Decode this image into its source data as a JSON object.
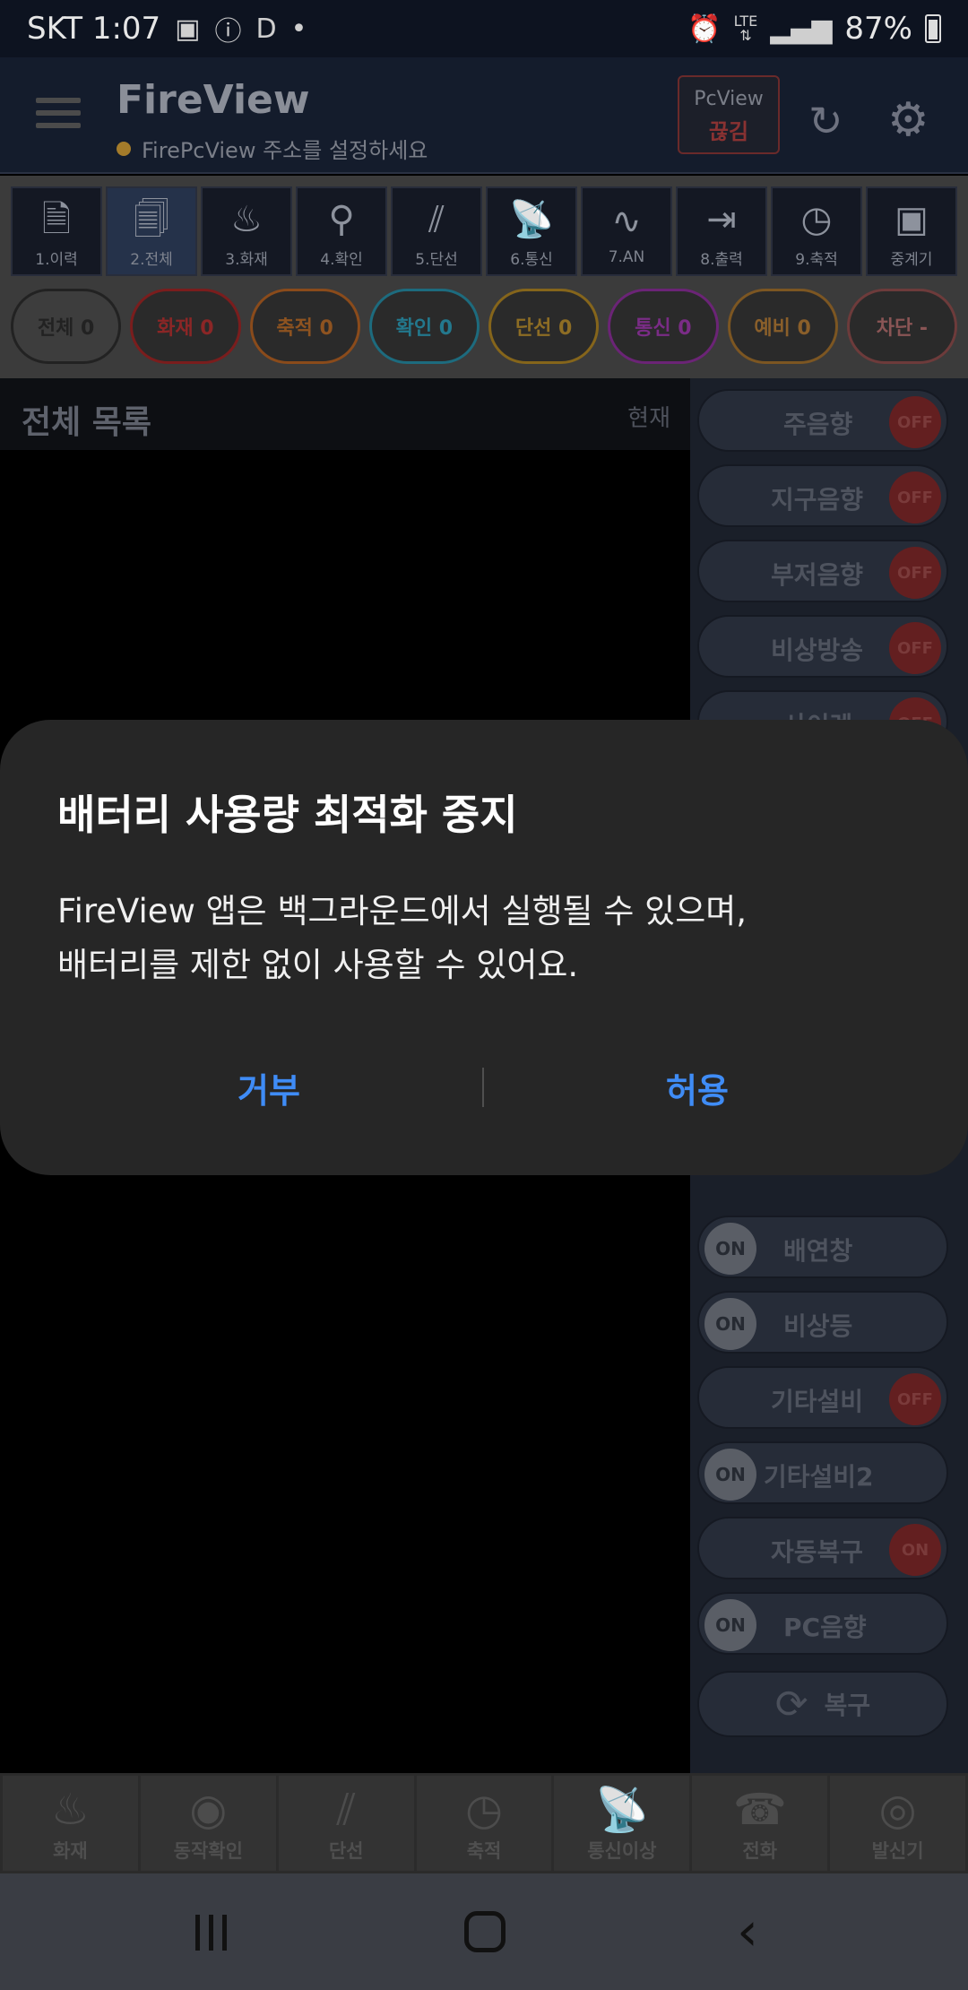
{
  "status_bar": {
    "carrier_time": "SKT 1:07",
    "network": "LTE",
    "battery": "87%"
  },
  "header": {
    "title": "FireView",
    "subtitle": "FirePcView 주소를 설정하세요",
    "pcview_label": "PcView",
    "pcview_status": "끊김"
  },
  "categories": [
    {
      "label": "1.이력",
      "icon": "document-icon"
    },
    {
      "label": "2.전체",
      "icon": "documents-icon"
    },
    {
      "label": "3.화재",
      "icon": "fire-icon"
    },
    {
      "label": "4.확인",
      "icon": "search-check-icon"
    },
    {
      "label": "5.단선",
      "icon": "broken-line-icon"
    },
    {
      "label": "6.통신",
      "icon": "satellite-icon"
    },
    {
      "label": "7.AN",
      "icon": "wave-icon"
    },
    {
      "label": "8.출력",
      "icon": "exit-icon"
    },
    {
      "label": "9.축적",
      "icon": "clock-icon"
    },
    {
      "label": "중계기",
      "icon": "relay-icon"
    }
  ],
  "chips": [
    {
      "label": "전체 0"
    },
    {
      "label": "화재 0"
    },
    {
      "label": "축적 0"
    },
    {
      "label": "확인 0"
    },
    {
      "label": "단선 0"
    },
    {
      "label": "통신 0"
    },
    {
      "label": "예비 0"
    },
    {
      "label": "차단 -"
    }
  ],
  "list": {
    "title": "전체 목록",
    "now_label": "현재"
  },
  "toggles": {
    "main_sound": {
      "label": "주음향",
      "state": "OFF"
    },
    "zone_sound": {
      "label": "지구음향",
      "state": "OFF"
    },
    "buzzer_sound": {
      "label": "부저음향",
      "state": "OFF"
    },
    "emergency_broadcast": {
      "label": "비상방송",
      "state": "OFF"
    },
    "siren": {
      "label": "사이렌",
      "state": "OFF"
    },
    "smoke_window": {
      "label": "배연창",
      "state": "ON"
    },
    "emergency_light": {
      "label": "비상등",
      "state": "ON"
    },
    "other_equipment": {
      "label": "기타설비",
      "state": "OFF"
    },
    "other_equipment2": {
      "label": "기타설비2",
      "state": "ON"
    },
    "auto_restore": {
      "label": "자동복구",
      "state": "ON"
    },
    "pc_sound": {
      "label": "PC음향",
      "state": "ON"
    },
    "restore_button": {
      "label": "복구"
    }
  },
  "bottom_tabs": [
    {
      "label": "화재",
      "icon": "fire-icon"
    },
    {
      "label": "동작확인",
      "icon": "eye-icon"
    },
    {
      "label": "단선",
      "icon": "broken-line-icon"
    },
    {
      "label": "축적",
      "icon": "clock-icon"
    },
    {
      "label": "통신이상",
      "icon": "satellite-icon"
    },
    {
      "label": "전화",
      "icon": "phone-icon"
    },
    {
      "label": "발신기",
      "icon": "bell-icon"
    }
  ],
  "dialog": {
    "title": "배터리 사용량 최적화 중지",
    "body_line1": "FireView 앱은 백그라운드에서 실행될 수 있으며,",
    "body_line2": "배터리를 제한 없이 사용할 수 있어요.",
    "deny_label": "거부",
    "allow_label": "허용"
  },
  "colors": {
    "accent": "#3f8cf6",
    "dialog_bg": "#262626",
    "off_red": "#631f20"
  }
}
